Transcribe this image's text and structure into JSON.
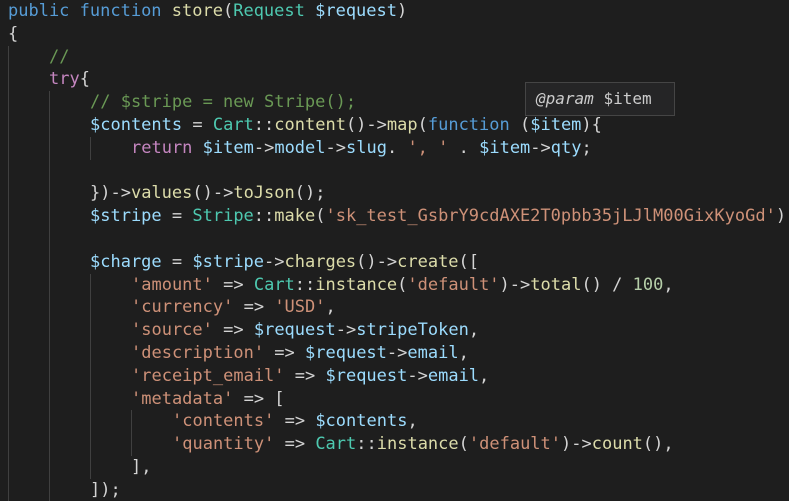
{
  "editor": {
    "lines": [
      {
        "indent": 0,
        "tokens": [
          {
            "c": "kw",
            "t": "public "
          },
          {
            "c": "kw",
            "t": "function "
          },
          {
            "c": "fn",
            "t": "store"
          },
          {
            "c": "pun",
            "t": "("
          },
          {
            "c": "cls",
            "t": "Request "
          },
          {
            "c": "var",
            "t": "$request"
          },
          {
            "c": "pun",
            "t": ")"
          }
        ]
      },
      {
        "indent": 0,
        "tokens": [
          {
            "c": "pun",
            "t": "{"
          }
        ]
      },
      {
        "indent": 1,
        "tokens": [
          {
            "c": "cmt",
            "t": "//"
          }
        ]
      },
      {
        "indent": 1,
        "tokens": [
          {
            "c": "ctl",
            "t": "try"
          },
          {
            "c": "pun",
            "t": "{"
          }
        ]
      },
      {
        "indent": 2,
        "tokens": [
          {
            "c": "cmt",
            "t": "// $stripe = new Stripe();"
          }
        ]
      },
      {
        "indent": 2,
        "tokens": [
          {
            "c": "var",
            "t": "$contents"
          },
          {
            "c": "pun",
            "t": " = "
          },
          {
            "c": "cls",
            "t": "Cart"
          },
          {
            "c": "pun",
            "t": "::"
          },
          {
            "c": "fn",
            "t": "content"
          },
          {
            "c": "pun",
            "t": "()->"
          },
          {
            "c": "fn",
            "t": "map"
          },
          {
            "c": "pun",
            "t": "("
          },
          {
            "c": "kw",
            "t": "function "
          },
          {
            "c": "pun",
            "t": "("
          },
          {
            "c": "var",
            "t": "$item"
          },
          {
            "c": "pun",
            "t": "){"
          }
        ]
      },
      {
        "indent": 3,
        "tokens": [
          {
            "c": "ctl",
            "t": "return "
          },
          {
            "c": "var",
            "t": "$item"
          },
          {
            "c": "pun",
            "t": "->"
          },
          {
            "c": "var",
            "t": "model"
          },
          {
            "c": "pun",
            "t": "->"
          },
          {
            "c": "var",
            "t": "slug"
          },
          {
            "c": "pun",
            "t": ". "
          },
          {
            "c": "str",
            "t": "', '"
          },
          {
            "c": "pun",
            "t": " . "
          },
          {
            "c": "var",
            "t": "$item"
          },
          {
            "c": "pun",
            "t": "->"
          },
          {
            "c": "var",
            "t": "qty"
          },
          {
            "c": "pun",
            "t": ";"
          }
        ]
      },
      {
        "indent": 2,
        "tokens": []
      },
      {
        "indent": 2,
        "tokens": [
          {
            "c": "pun",
            "t": "})->"
          },
          {
            "c": "fn",
            "t": "values"
          },
          {
            "c": "pun",
            "t": "()->"
          },
          {
            "c": "fn",
            "t": "toJson"
          },
          {
            "c": "pun",
            "t": "();"
          }
        ]
      },
      {
        "indent": 2,
        "tokens": [
          {
            "c": "var",
            "t": "$stripe"
          },
          {
            "c": "pun",
            "t": " = "
          },
          {
            "c": "cls",
            "t": "Stripe"
          },
          {
            "c": "pun",
            "t": "::"
          },
          {
            "c": "fn",
            "t": "make"
          },
          {
            "c": "pun",
            "t": "("
          },
          {
            "c": "str",
            "t": "'sk_test_GsbrY9cdAXE2T0pbb35jLJlM00GixKyoGd'"
          },
          {
            "c": "pun",
            "t": ");"
          }
        ]
      },
      {
        "indent": 2,
        "tokens": []
      },
      {
        "indent": 2,
        "tokens": [
          {
            "c": "var",
            "t": "$charge"
          },
          {
            "c": "pun",
            "t": " = "
          },
          {
            "c": "var",
            "t": "$stripe"
          },
          {
            "c": "pun",
            "t": "->"
          },
          {
            "c": "fn",
            "t": "charges"
          },
          {
            "c": "pun",
            "t": "()->"
          },
          {
            "c": "fn",
            "t": "create"
          },
          {
            "c": "pun",
            "t": "(["
          }
        ]
      },
      {
        "indent": 3,
        "tokens": [
          {
            "c": "str",
            "t": "'amount'"
          },
          {
            "c": "pun",
            "t": " => "
          },
          {
            "c": "cls",
            "t": "Cart"
          },
          {
            "c": "pun",
            "t": "::"
          },
          {
            "c": "fn",
            "t": "instance"
          },
          {
            "c": "pun",
            "t": "("
          },
          {
            "c": "str",
            "t": "'default'"
          },
          {
            "c": "pun",
            "t": ")->"
          },
          {
            "c": "fn",
            "t": "total"
          },
          {
            "c": "pun",
            "t": "() / "
          },
          {
            "c": "num",
            "t": "100"
          },
          {
            "c": "pun",
            "t": ","
          }
        ]
      },
      {
        "indent": 3,
        "tokens": [
          {
            "c": "str",
            "t": "'currency'"
          },
          {
            "c": "pun",
            "t": " => "
          },
          {
            "c": "str",
            "t": "'USD'"
          },
          {
            "c": "pun",
            "t": ","
          }
        ]
      },
      {
        "indent": 3,
        "tokens": [
          {
            "c": "str",
            "t": "'source'"
          },
          {
            "c": "pun",
            "t": " => "
          },
          {
            "c": "var",
            "t": "$request"
          },
          {
            "c": "pun",
            "t": "->"
          },
          {
            "c": "var",
            "t": "stripeToken"
          },
          {
            "c": "pun",
            "t": ","
          }
        ]
      },
      {
        "indent": 3,
        "tokens": [
          {
            "c": "str",
            "t": "'description'"
          },
          {
            "c": "pun",
            "t": " => "
          },
          {
            "c": "var",
            "t": "$request"
          },
          {
            "c": "pun",
            "t": "->"
          },
          {
            "c": "var",
            "t": "email"
          },
          {
            "c": "pun",
            "t": ","
          }
        ]
      },
      {
        "indent": 3,
        "tokens": [
          {
            "c": "str",
            "t": "'receipt_email'"
          },
          {
            "c": "pun",
            "t": " => "
          },
          {
            "c": "var",
            "t": "$request"
          },
          {
            "c": "pun",
            "t": "->"
          },
          {
            "c": "var",
            "t": "email"
          },
          {
            "c": "pun",
            "t": ","
          }
        ]
      },
      {
        "indent": 3,
        "tokens": [
          {
            "c": "str",
            "t": "'metadata'"
          },
          {
            "c": "pun",
            "t": " => ["
          }
        ]
      },
      {
        "indent": 4,
        "tokens": [
          {
            "c": "str",
            "t": "'contents'"
          },
          {
            "c": "pun",
            "t": " => "
          },
          {
            "c": "var",
            "t": "$contents"
          },
          {
            "c": "pun",
            "t": ","
          }
        ]
      },
      {
        "indent": 4,
        "tokens": [
          {
            "c": "str",
            "t": "'quantity'"
          },
          {
            "c": "pun",
            "t": " => "
          },
          {
            "c": "cls",
            "t": "Cart"
          },
          {
            "c": "pun",
            "t": "::"
          },
          {
            "c": "fn",
            "t": "instance"
          },
          {
            "c": "pun",
            "t": "("
          },
          {
            "c": "str",
            "t": "'default'"
          },
          {
            "c": "pun",
            "t": ")->"
          },
          {
            "c": "fn",
            "t": "count"
          },
          {
            "c": "pun",
            "t": "(),"
          }
        ]
      },
      {
        "indent": 3,
        "tokens": [
          {
            "c": "pun",
            "t": "],"
          }
        ]
      },
      {
        "indent": 2,
        "tokens": [
          {
            "c": "pun",
            "t": "]);"
          }
        ]
      }
    ]
  },
  "hover_tooltip": {
    "tag": "@param",
    "name": "$item"
  },
  "theme": {
    "background": "#1e1e1e",
    "keyword": "#569cd6",
    "control": "#c586c0",
    "function": "#dcdcaa",
    "class": "#4ec9b0",
    "variable": "#9cdcfe",
    "string": "#ce9178",
    "number": "#b5cea8",
    "comment": "#6a9955"
  }
}
